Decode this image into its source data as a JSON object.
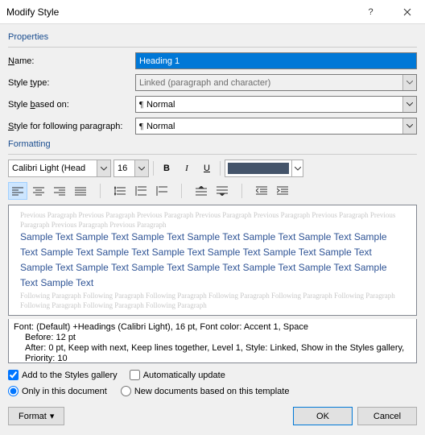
{
  "title": "Modify Style",
  "sections": {
    "properties": "Properties",
    "formatting": "Formatting"
  },
  "fields": {
    "name": {
      "label": "Name:",
      "value": "Heading 1"
    },
    "styleType": {
      "label": "Style type:",
      "value": "Linked (paragraph and character)"
    },
    "basedOn": {
      "label": "Style based on:",
      "value": "Normal"
    },
    "following": {
      "label": "Style for following paragraph:",
      "value": "Normal"
    }
  },
  "format": {
    "font": "Calibri Light (Head",
    "size": "16",
    "bold": "B",
    "italic": "I",
    "underline": "U",
    "color": "#44546a"
  },
  "preview": {
    "ghostBefore": "Previous Paragraph Previous Paragraph Previous Paragraph Previous Paragraph Previous Paragraph Previous Paragraph Previous Paragraph Previous Paragraph Previous Paragraph",
    "sample": "Sample Text Sample Text Sample Text Sample Text Sample Text Sample Text Sample Text Sample Text Sample Text Sample Text Sample Text Sample Text Sample Text Sample Text Sample Text Sample Text Sample Text Sample Text Sample Text Sample Text Sample Text",
    "ghostAfter": "Following Paragraph Following Paragraph Following Paragraph Following Paragraph Following Paragraph Following Paragraph Following Paragraph Following Paragraph Following Paragraph"
  },
  "description": {
    "line1": "Font: (Default) +Headings (Calibri Light), 16 pt, Font color: Accent 1, Space",
    "line2": "Before:  12 pt",
    "line3": "After:  0 pt, Keep with next, Keep lines together, Level 1, Style: Linked, Show in the Styles gallery, Priority: 10"
  },
  "checks": {
    "addGallery": "Add to the Styles gallery",
    "autoUpdate": "Automatically update"
  },
  "radios": {
    "onlyDoc": "Only in this document",
    "newDocs": "New documents based on this template"
  },
  "buttons": {
    "format": "Format",
    "ok": "OK",
    "cancel": "Cancel"
  }
}
